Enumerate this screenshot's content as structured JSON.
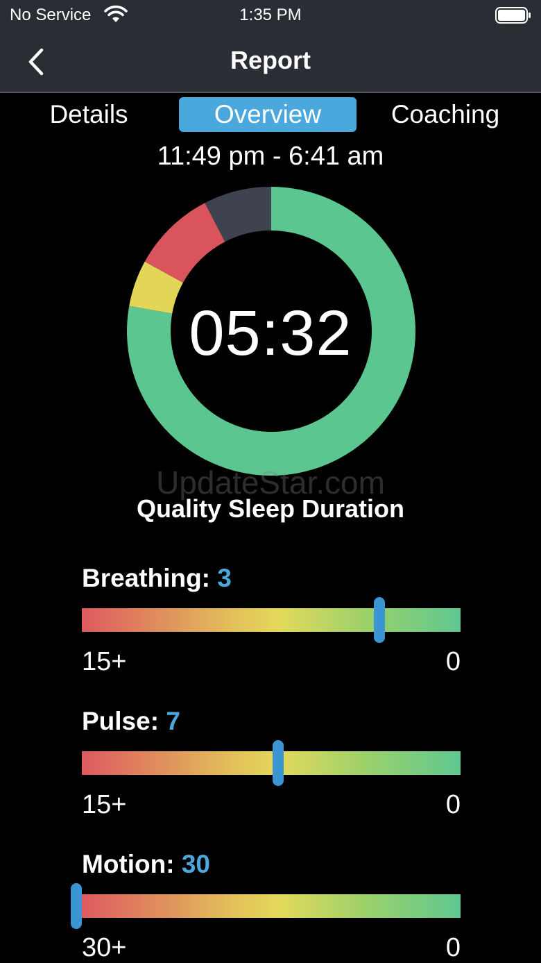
{
  "status_bar": {
    "carrier": "No Service",
    "time": "1:35 PM",
    "wifi_icon": "wifi-icon",
    "battery_icon": "battery-full-icon"
  },
  "nav": {
    "title": "Report",
    "back_icon": "chevron-left-icon"
  },
  "tabs": [
    {
      "label": "Details",
      "selected": false
    },
    {
      "label": "Overview",
      "selected": true
    },
    {
      "label": "Coaching",
      "selected": false
    }
  ],
  "overview": {
    "time_range": "11:49 pm - 6:41 am",
    "duration": "05:32",
    "duration_label": "Quality Sleep Duration",
    "watermark": "UpdateStar.com",
    "ring_segments": [
      {
        "color": "#5cc690",
        "fraction": 0.778
      },
      {
        "color": "#e2d557",
        "fraction": 0.052
      },
      {
        "color": "#d9545c",
        "fraction": 0.094
      },
      {
        "color": "#3f4350",
        "fraction": 0.076
      }
    ]
  },
  "metrics": [
    {
      "name": "breathing",
      "label": "Breathing:",
      "value": "3",
      "min_label": "15+",
      "max_label": "0",
      "level": 0.785
    },
    {
      "name": "pulse",
      "label": "Pulse:",
      "value": "7",
      "min_label": "15+",
      "max_label": "0",
      "level": 0.518
    },
    {
      "name": "motion",
      "label": "Motion:",
      "value": "30",
      "min_label": "30+",
      "max_label": "0",
      "level": -0.015
    }
  ],
  "colors": {
    "accent": "#4ba8dd",
    "bar_background": "#2a2d33"
  }
}
